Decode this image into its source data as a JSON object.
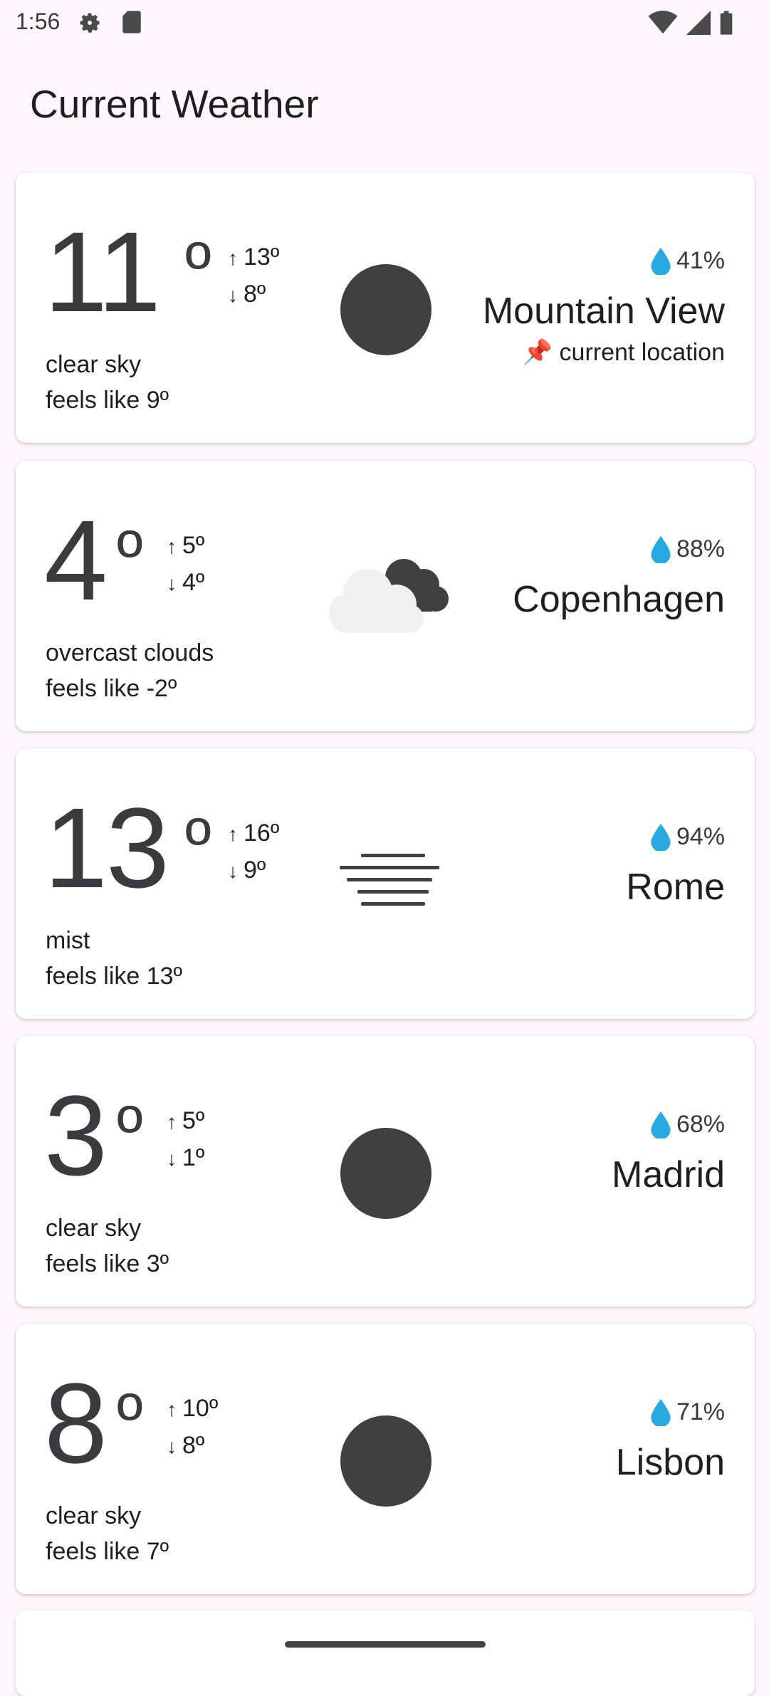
{
  "status_bar": {
    "time": "1:56",
    "icons": [
      "settings-gear-icon",
      "sd-card-icon",
      "wifi-icon",
      "cell-signal-icon",
      "battery-icon"
    ]
  },
  "app": {
    "title": "Current Weather"
  },
  "colors": {
    "drop": "#29a9e1",
    "icon_dark": "#404040",
    "cloud_light": "#f0f0f0"
  },
  "cards": [
    {
      "temp": "11",
      "deg": "º",
      "high": "13º",
      "low": "8º",
      "description": "clear sky",
      "feels_like": "feels like 9º",
      "humidity": "41%",
      "city": "Mountain View",
      "location_label": "📌 current location",
      "icon": "clear-sky-icon"
    },
    {
      "temp": "4",
      "deg": "º",
      "high": "5º",
      "low": "4º",
      "description": "overcast clouds",
      "feels_like": "feels like -2º",
      "humidity": "88%",
      "city": "Copenhagen",
      "icon": "overcast-clouds-icon"
    },
    {
      "temp": "13",
      "deg": "º",
      "high": "16º",
      "low": "9º",
      "description": "mist",
      "feels_like": "feels like 13º",
      "humidity": "94%",
      "city": "Rome",
      "icon": "mist-icon"
    },
    {
      "temp": "3",
      "deg": "º",
      "high": "5º",
      "low": "1º",
      "description": "clear sky",
      "feels_like": "feels like 3º",
      "humidity": "68%",
      "city": "Madrid",
      "icon": "clear-sky-icon"
    },
    {
      "temp": "8",
      "deg": "º",
      "high": "10º",
      "low": "8º",
      "description": "clear sky",
      "feels_like": "feels like 7º",
      "humidity": "71%",
      "city": "Lisbon",
      "icon": "clear-sky-icon"
    }
  ]
}
